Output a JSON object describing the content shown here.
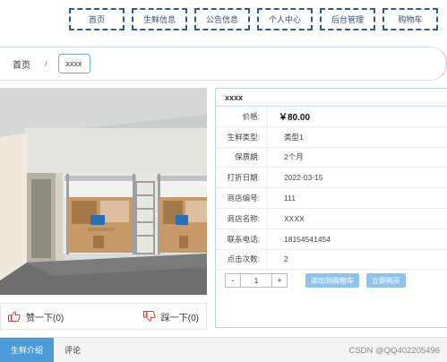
{
  "nav": {
    "items": [
      "首页",
      "生鲜信息",
      "公告信息",
      "个人中心",
      "后台管理",
      "购物车"
    ]
  },
  "breadcrumb": {
    "home": "首页",
    "separator": "/",
    "current": "xxxx"
  },
  "product": {
    "title": "xxxx",
    "image_icon": "dormitory-room-photo",
    "price_label": "价格:",
    "price": "￥80.00",
    "rows": [
      {
        "label": "生鲜类型:",
        "value": "类型1"
      },
      {
        "label": "保质期:",
        "value": "2个月"
      },
      {
        "label": "打折日期:",
        "value": "2022-03-15"
      },
      {
        "label": "商店编号:",
        "value": "111"
      },
      {
        "label": "商店名称:",
        "value": "XXXX"
      },
      {
        "label": "联系电话:",
        "value": "18154541454"
      },
      {
        "label": "点击次数:",
        "value": "2"
      }
    ],
    "quantity": {
      "minus": "-",
      "value": "1",
      "plus": "+"
    },
    "add_to_cart": "添加到购物车",
    "buy_now": "立即购买"
  },
  "votes": {
    "like_label": "赞一下(0)",
    "like_icon": "thumbs-up-icon",
    "dislike_label": "踩一下(0)",
    "dislike_icon": "thumbs-down-icon"
  },
  "tabs": [
    "生鲜介绍",
    "评论"
  ],
  "watermark": "CSDN @QQ402205496",
  "colors": {
    "nav_border": "#2f5a8a",
    "accent": "#4a9bd8",
    "button": "#8fc3ec",
    "icon_red": "#d83a3a"
  }
}
